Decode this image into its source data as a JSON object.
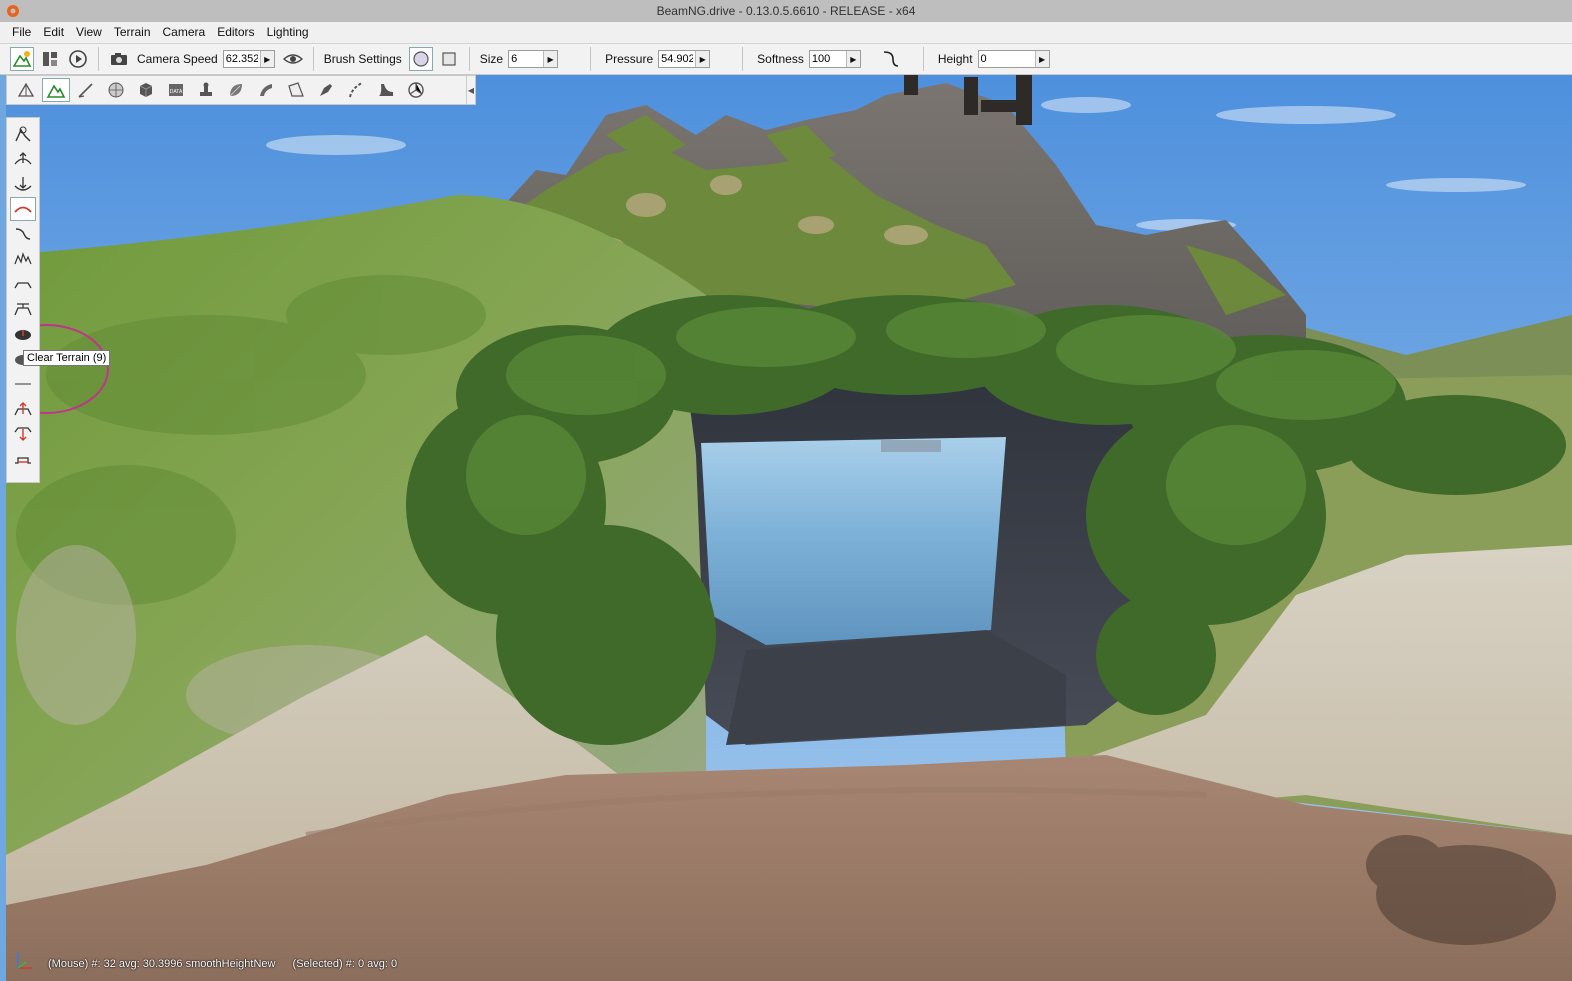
{
  "window": {
    "title": "BeamNG.drive - 0.13.0.5.6610 - RELEASE - x64"
  },
  "menu": [
    "File",
    "Edit",
    "View",
    "Terrain",
    "Camera",
    "Editors",
    "Lighting"
  ],
  "toolbar": {
    "camera_speed_label": "Camera Speed",
    "camera_speed_value": "62.352",
    "brush_settings_label": "Brush Settings",
    "size_label": "Size",
    "size_value": "6",
    "pressure_label": "Pressure",
    "pressure_value": "54.902",
    "softness_label": "Softness",
    "softness_value": "100",
    "height_label": "Height",
    "height_value": "0"
  },
  "tooltip": "Clear Terrain (9)",
  "status": {
    "mouse": "(Mouse) #: 32  avg: 30.3996 smoothHeightNew",
    "selected": "(Selected) #: 0  avg: 0"
  },
  "colors": {
    "accent_red": "#d23a2a",
    "brush_ring": "#c0348e"
  }
}
